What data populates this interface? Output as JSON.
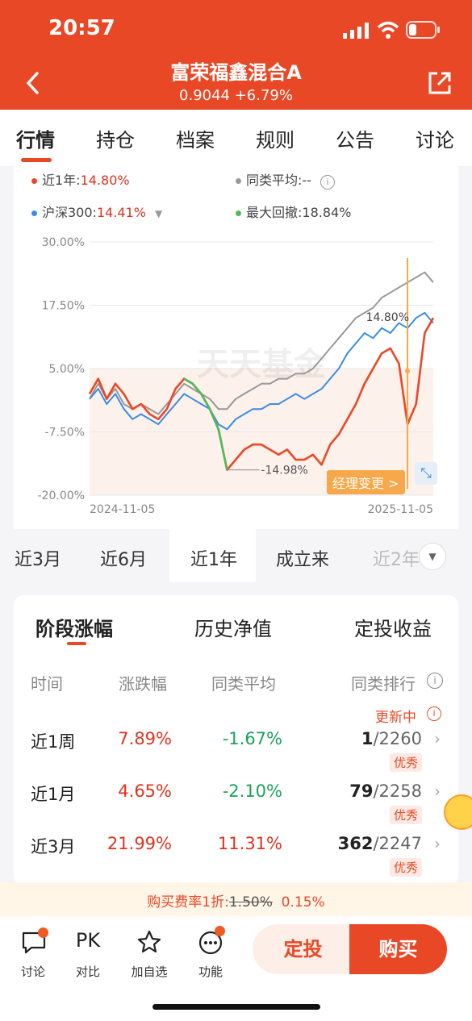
{
  "status": {
    "time": "20:57"
  },
  "header": {
    "title": "富荣福鑫混合A",
    "subtitle": "0.9044  +6.79%",
    "back_icon": "back-arrow-icon",
    "share_icon": "share-icon"
  },
  "tabs": [
    "行情",
    "持仓",
    "档案",
    "规则",
    "公告",
    "讨论"
  ],
  "legend": {
    "fund": "近1年:",
    "fund_value": "14.80%",
    "peer": "同类平均:",
    "peer_value": "--",
    "index": "沪深300:",
    "index_value": "14.41%",
    "drawdown": "最大回撤:",
    "drawdown_value": "18.84%"
  },
  "chart_data": {
    "type": "line",
    "ylim": [
      -20,
      30
    ],
    "yticks": [
      "30.00%",
      "17.50%",
      "5.00%",
      "-7.50%",
      "-20.00%"
    ],
    "x_start": "2024-11-05",
    "x_end": "2025-11-05",
    "watermark": "天天基金",
    "annotations": {
      "end_label": "14.80%",
      "min_label": "-14.98%",
      "manager_change": "经理变更 >"
    },
    "series": [
      {
        "name": "近1年",
        "color": "#e94826",
        "values": [
          0,
          3,
          -1,
          2,
          0,
          -3,
          -2,
          -4,
          -5,
          -3,
          1,
          3,
          2,
          0,
          -3,
          -7,
          -15,
          -13,
          -11,
          -10,
          -10,
          -11,
          -12,
          -11,
          -13,
          -13,
          -12,
          -14,
          -10,
          -8,
          -5,
          -2,
          2,
          5,
          8,
          9,
          6,
          -6,
          -2,
          12,
          15
        ]
      },
      {
        "name": "沪深300",
        "color": "#3a8de0",
        "values": [
          -1,
          1,
          -2,
          0,
          -3,
          -5,
          -4,
          -5,
          -6,
          -4,
          -2,
          0,
          -1,
          -2,
          -3,
          -6,
          -7,
          -5,
          -4,
          -3,
          -3,
          -2,
          -2,
          -1,
          0,
          -1,
          0,
          1,
          3,
          5,
          8,
          10,
          12,
          11,
          13,
          12,
          14,
          13,
          15,
          16,
          14
        ]
      },
      {
        "name": "同类平均",
        "color": "#999999",
        "values": [
          -1,
          2,
          -1,
          1,
          -2,
          -3,
          -2,
          -3,
          -4,
          -2,
          0,
          2,
          1,
          0,
          -1,
          -3,
          -3,
          -1,
          0,
          1,
          2,
          2,
          3,
          3,
          4,
          4,
          5,
          7,
          9,
          11,
          13,
          15,
          16,
          17,
          19,
          20,
          21,
          22,
          23,
          24,
          22
        ]
      }
    ]
  },
  "periods": [
    "近3月",
    "近6月",
    "近1年",
    "成立来",
    "近2年"
  ],
  "stage": {
    "subtabs": [
      "阶段涨幅",
      "历史净值",
      "定投收益"
    ],
    "headers": [
      "时间",
      "涨跌幅",
      "同类平均",
      "同类排行"
    ],
    "updating": "更新中",
    "rows": [
      {
        "period": "近1周",
        "change": "7.89%",
        "avg": "-1.67%",
        "rank": "1",
        "total": "/2260",
        "badge": "优秀"
      },
      {
        "period": "近1月",
        "change": "4.65%",
        "avg": "-2.10%",
        "rank": "79",
        "total": "/2258",
        "badge": "优秀"
      },
      {
        "period": "近3月",
        "change": "21.99%",
        "avg": "11.31%",
        "rank": "362",
        "total": "/2247",
        "badge": "优秀"
      }
    ]
  },
  "fee": {
    "label": "购买费率1折:",
    "old": "1.50%",
    "new": "0.15%"
  },
  "bottom": {
    "discuss": "讨论",
    "compare": "对比",
    "compare_icon": "PK",
    "watch": "加自选",
    "function": "功能",
    "plan_button": "定投",
    "buy_button": "购买"
  }
}
